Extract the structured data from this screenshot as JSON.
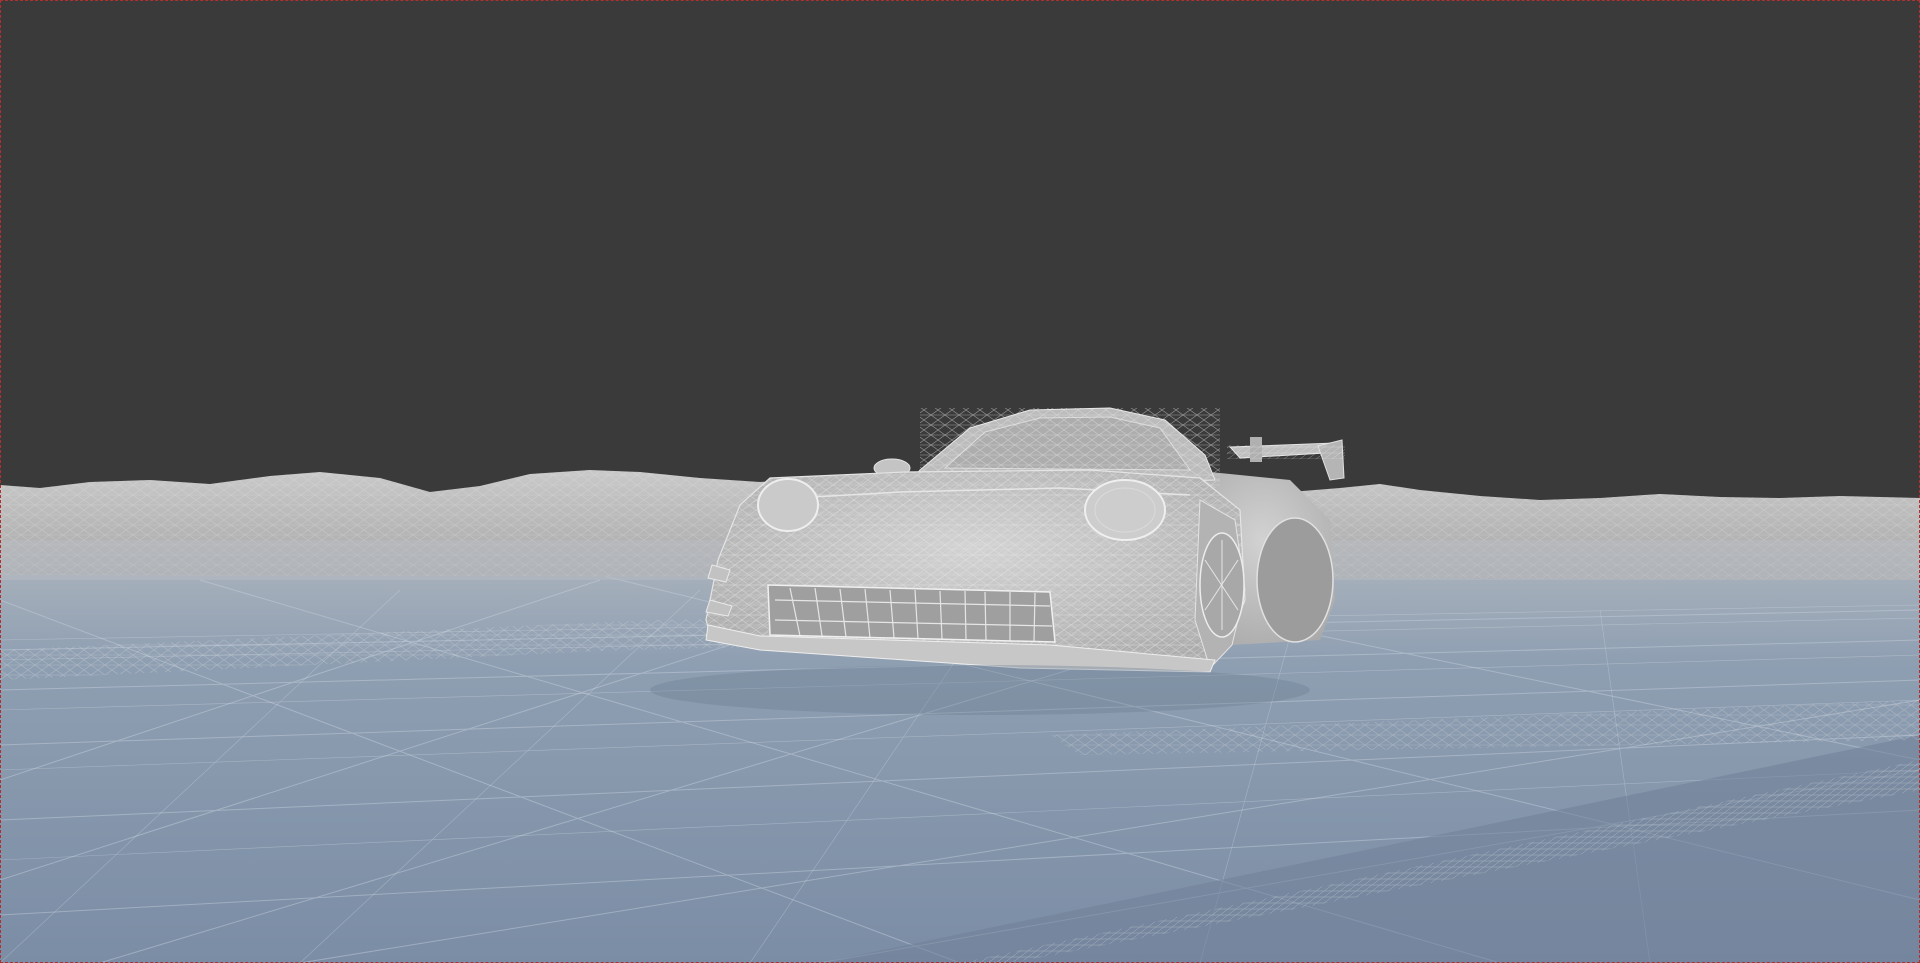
{
  "viewport": {
    "mode": "wireframe",
    "background_color": "#3a3a3a",
    "ground_color": "#7d8fa6",
    "terrain_color": "#b9b9b9",
    "car_color": "#c4c4c4",
    "frame_border_color": "#b03030"
  }
}
